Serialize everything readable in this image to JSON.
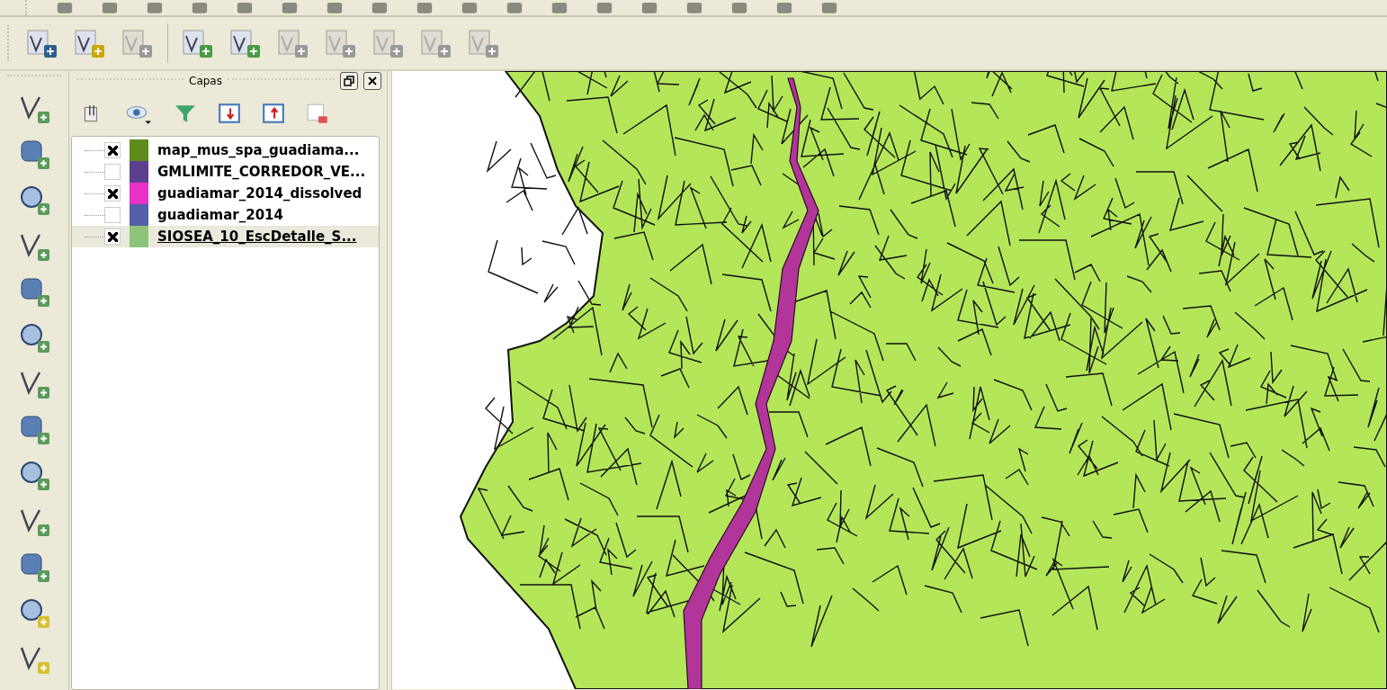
{
  "layers_panel": {
    "title": "Capas",
    "layers": [
      {
        "name": "map_mus_spa_guadiama...",
        "checked": true,
        "color": "#5f8c1c",
        "selected": false
      },
      {
        "name": "GMLIMITE_CORREDOR_VE...",
        "checked": false,
        "color": "#5e3f8f",
        "selected": false
      },
      {
        "name": "guadiamar_2014_dissolved",
        "checked": true,
        "color": "#e832c8",
        "selected": false
      },
      {
        "name": "guadiamar_2014",
        "checked": false,
        "color": "#5560a8",
        "selected": false
      },
      {
        "name": "SIOSEA_10_EscDetalle_S...",
        "checked": true,
        "color": "#8ec47a",
        "selected": true
      }
    ]
  }
}
